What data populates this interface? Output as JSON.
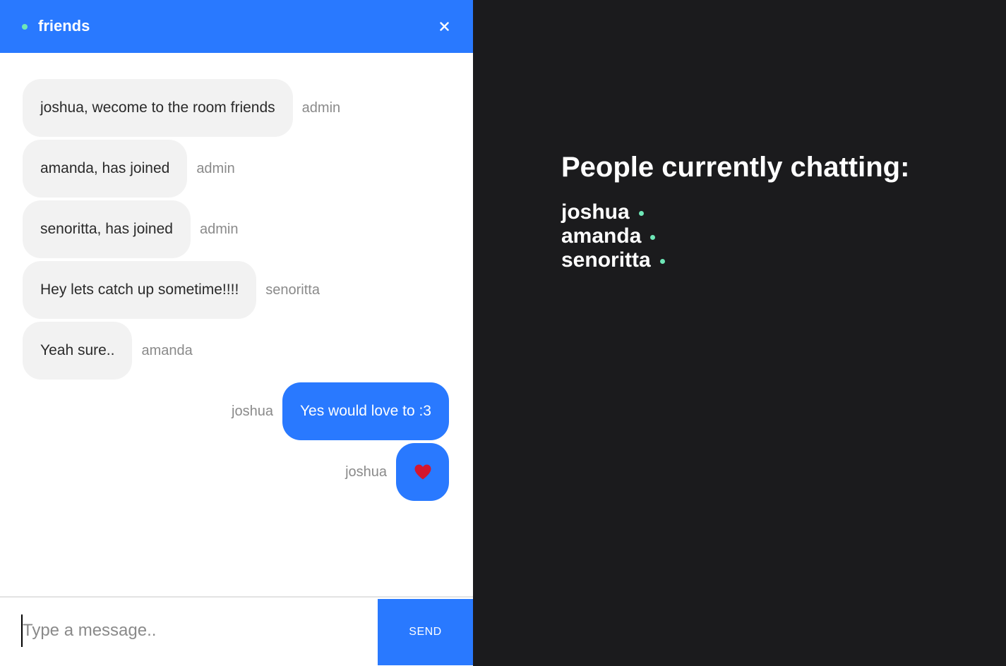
{
  "chat": {
    "room_name": "friends",
    "close_icon": "close-icon",
    "status_color": "#6ee7b7",
    "accent_color": "#2979ff",
    "messages": [
      {
        "text": "joshua, wecome to the room friends",
        "sender": "admin",
        "side": "left"
      },
      {
        "text": "amanda, has joined",
        "sender": "admin",
        "side": "left"
      },
      {
        "text": "senoritta, has joined",
        "sender": "admin",
        "side": "left"
      },
      {
        "text": "Hey lets catch up sometime!!!!",
        "sender": "senoritta",
        "side": "left"
      },
      {
        "text": "Yeah sure..",
        "sender": "amanda",
        "side": "left"
      },
      {
        "text": "Yes would love to :3",
        "sender": "joshua",
        "side": "right"
      },
      {
        "icon": "heart-icon",
        "sender": "joshua",
        "side": "right"
      }
    ],
    "composer": {
      "placeholder": "Type a message..",
      "value": "",
      "send_label": "SEND"
    }
  },
  "people": {
    "title": "People currently chatting:",
    "users": [
      {
        "name": "joshua",
        "status": "online"
      },
      {
        "name": "amanda",
        "status": "online"
      },
      {
        "name": "senoritta",
        "status": "online"
      }
    ]
  }
}
